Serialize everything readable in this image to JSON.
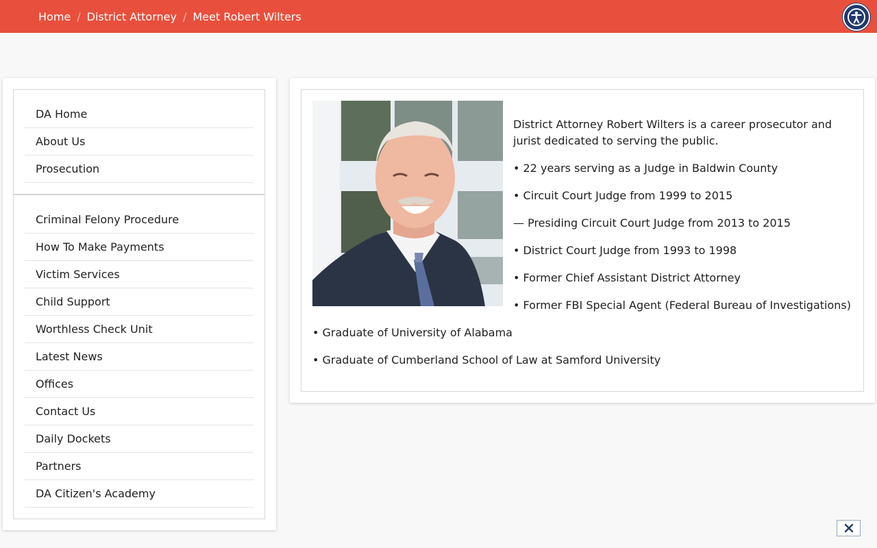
{
  "breadcrumb": [
    "Home",
    "District Attorney",
    "Meet Robert Wilters"
  ],
  "accessibility_button": {
    "icon": "accessibility-icon"
  },
  "sidebar": {
    "primary_items": [
      "DA Home",
      "About Us",
      "Prosecution"
    ],
    "secondary_items": [
      "Criminal Felony Procedure",
      "How To Make Payments",
      "Victim Services",
      "Child Support",
      "Worthless Check Unit",
      "Latest News",
      "Offices",
      "Contact Us",
      "Daily Dockets",
      "Partners",
      "DA Citizen's Academy"
    ]
  },
  "bio": {
    "photo_alt": "District Attorney Robert Wilters",
    "intro": "District Attorney Robert Wilters is a career prosecutor and jurist dedicated to serving the public.",
    "lines": [
      "• 22 years serving as a Judge in Baldwin County",
      "• Circuit Court Judge from 1999 to 2015",
      "— Presiding Circuit Court Judge from 2013 to 2015",
      "• District Court Judge from 1993 to 1998",
      "• Former Chief Assistant District Attorney",
      "• Former FBI Special Agent (Federal Bureau of Investigations)",
      "• Graduate of University of Alabama",
      "• Graduate of Cumberland School of Law at Samford University"
    ]
  },
  "colors": {
    "topbar": "#e8503d",
    "accessibility": "#1f3a6e"
  }
}
